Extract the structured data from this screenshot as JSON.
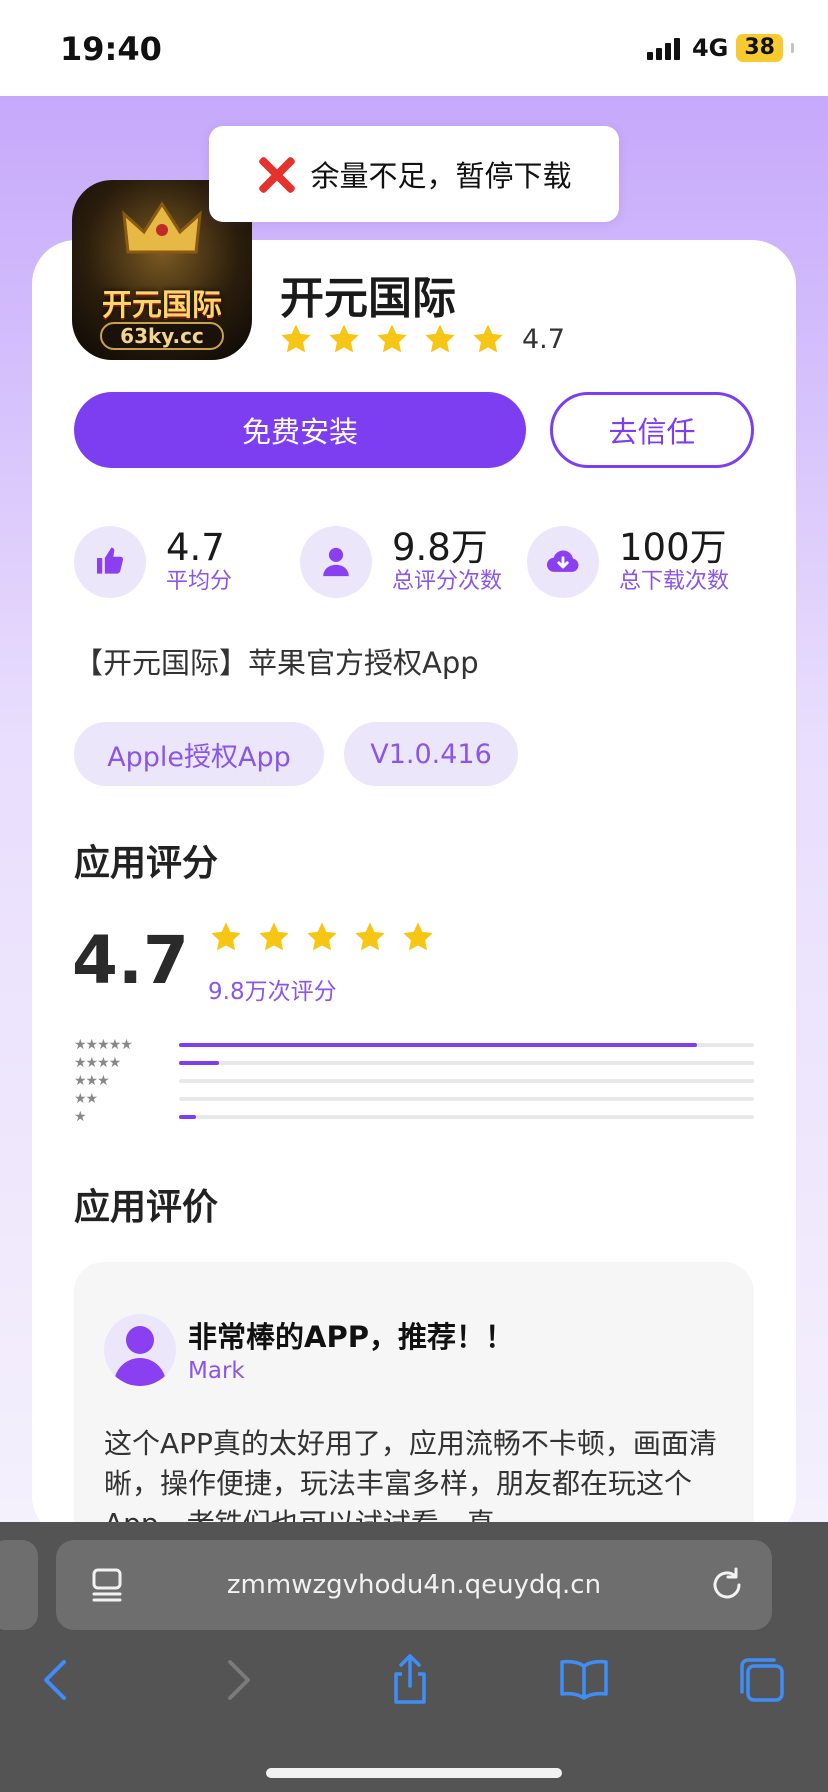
{
  "status_bar": {
    "time": "19:40",
    "network": "4G",
    "battery": "38"
  },
  "toast": {
    "text": "余量不足，暂停下载"
  },
  "app": {
    "icon_brand": "开元国际",
    "icon_domain": "63ky.cc",
    "name": "开元国际",
    "rating": "4.7",
    "stars": 5
  },
  "buttons": {
    "install": "免费安装",
    "trust": "去信任"
  },
  "stats": [
    {
      "icon": "thumbs-up-icon",
      "value": "4.7",
      "label": "平均分"
    },
    {
      "icon": "user-icon",
      "value": "9.8万",
      "label": "总评分次数"
    },
    {
      "icon": "cloud-download-icon",
      "value": "100万",
      "label": "总下载次数"
    }
  ],
  "description": "【开元国际】苹果官方授权App",
  "tags": [
    "Apple授权App",
    "V1.0.416"
  ],
  "rating_section": {
    "title": "应用评分",
    "score": "4.7",
    "count_text": "9.8万次评分",
    "distribution": [
      {
        "stars": "★★★★★",
        "fraction": 0.9
      },
      {
        "stars": "★★★★",
        "fraction": 0.07
      },
      {
        "stars": "★★★",
        "fraction": 0
      },
      {
        "stars": "★★",
        "fraction": 0
      },
      {
        "stars": "★",
        "fraction": 0.03
      }
    ]
  },
  "review_section": {
    "title": "应用评价",
    "review": {
      "title": "非常棒的APP，推荐！！",
      "author": "Mark",
      "body": "这个APP真的太好用了，应用流畅不卡顿，画面清晰，操作便捷，玩法丰富多样，朋友都在玩这个App，老铁们也可以试试看，真"
    }
  },
  "browser": {
    "url": "zmmwzgvhodu4n.qeuydq.cn"
  },
  "colors": {
    "accent": "#7c3ef0",
    "star": "#f7c514",
    "toast_x": "#e5322d"
  }
}
